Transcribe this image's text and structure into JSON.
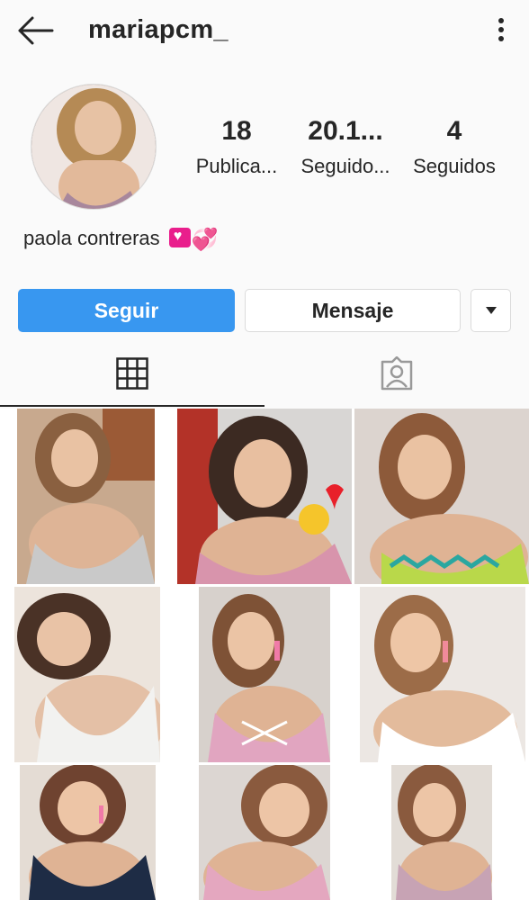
{
  "header": {
    "username": "mariapcm_",
    "back_icon": "arrow-left-icon",
    "more_icon": "more-vertical-icon"
  },
  "profile": {
    "display_name": "paola contreras",
    "stats": [
      {
        "value": "18",
        "label": "Publica..."
      },
      {
        "value": "20.1...",
        "label": "Seguido..."
      },
      {
        "value": "4",
        "label": "Seguidos"
      }
    ]
  },
  "actions": {
    "follow_label": "Seguir",
    "message_label": "Mensaje",
    "dropdown_icon": "caret-down-icon"
  },
  "tabs": [
    {
      "name": "grid",
      "icon": "grid-icon",
      "active": true
    },
    {
      "name": "tagged",
      "icon": "tagged-person-icon",
      "active": false
    }
  ],
  "colors": {
    "accent": "#3897f0",
    "text": "#262626",
    "border": "#dbdbdb",
    "background": "#fafafa"
  }
}
